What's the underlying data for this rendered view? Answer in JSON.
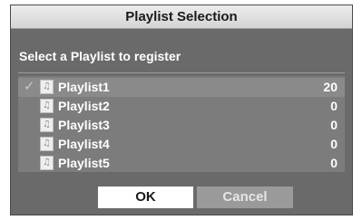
{
  "dialog": {
    "title": "Playlist Selection",
    "prompt": "Select a Playlist to register"
  },
  "playlists": [
    {
      "name": "Playlist1",
      "count": "20",
      "checked": true
    },
    {
      "name": "Playlist2",
      "count": "0",
      "checked": false
    },
    {
      "name": "Playlist3",
      "count": "0",
      "checked": false
    },
    {
      "name": "Playlist4",
      "count": "0",
      "checked": false
    },
    {
      "name": "Playlist5",
      "count": "0",
      "checked": false
    }
  ],
  "buttons": {
    "ok_label": "OK",
    "cancel_label": "Cancel"
  },
  "icons": {
    "check": "checkmark-icon",
    "playlist": "music-note-icon"
  },
  "colors": {
    "dialog_bg": "#6a6a6a",
    "list_bg": "#7c7c7c",
    "selected_row": "#8a8a8a",
    "ok_button": "#ffffff",
    "cancel_button": "#9a9a9a"
  }
}
